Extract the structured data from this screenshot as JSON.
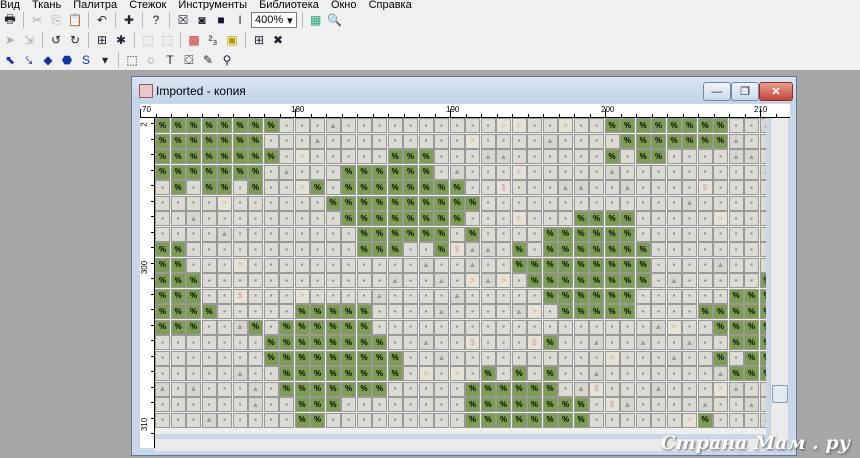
{
  "menu": [
    "Вид",
    "Ткань",
    "Палитра",
    "Стежок",
    "Инструменты",
    "Библиотека",
    "Окно",
    "Справка"
  ],
  "toolbar1": {
    "zoom_value": "400%",
    "icons": [
      "print-icon",
      "cut-icon",
      "copy-icon",
      "paste-icon",
      "undo-icon",
      "new-stitch-icon",
      "help-icon",
      "x-icon",
      "fill-icon",
      "square-icon",
      "text-icon",
      "palette-grid-icon",
      "zoom-icon"
    ]
  },
  "toolbar2": {
    "icons": [
      "pointer-icon",
      "rotate-left-icon",
      "rotate-right-icon",
      "grid-icon",
      "bug-icon",
      "select-icon",
      "select2-icon",
      "color-swatch-icon",
      "superscript-icon",
      "pattern-icon",
      "table-icon",
      "cross-icon"
    ]
  },
  "toolbar3": {
    "s_label": "S",
    "t_label": "T",
    "icons": [
      "diag-arrow-icon",
      "arrow2-icon",
      "dot-icon",
      "blob-icon",
      "s-icon",
      "rect-select-icon",
      "lasso-icon",
      "text-tool-icon",
      "bucket-icon",
      "eyedropper-icon",
      "magnifier-icon"
    ]
  },
  "window": {
    "title": "Imported - копия",
    "minimize": "—",
    "restore": "❐",
    "close": "✕"
  },
  "ruler_top": [
    "70",
    "180",
    "190",
    "200",
    "210"
  ],
  "ruler_left": [
    "2",
    "300",
    "310"
  ],
  "symbols": {
    "dark": "%",
    "light": "▪",
    "tri": "▲",
    "dollar": "$",
    "arrow": ">"
  },
  "watermark": "Страна Мам . ру"
}
